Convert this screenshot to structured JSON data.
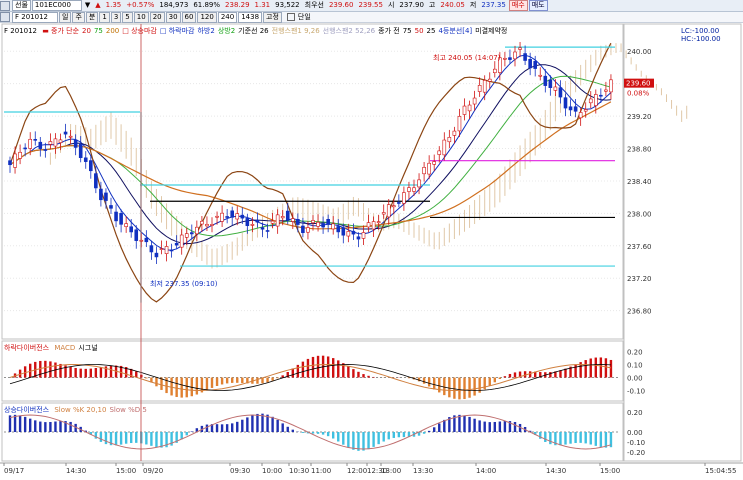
{
  "toolbar1": {
    "type_select": "선물",
    "code_field": "101EC000",
    "arrow_down": "▼",
    "change_label": "▲",
    "change_value": "1.35",
    "change_pct": "+0.57%",
    "volume": "184,973",
    "ratio": "61.89%",
    "price1": "238.29",
    "price2": "1.31",
    "volume2": "93,522",
    "best_ask_label": "최우선",
    "best_ask": "239.60",
    "best_bid": "239.55",
    "open_label": "시",
    "open": "237.90",
    "high_label": "고",
    "high": "240.05",
    "low_label": "저",
    "low": "237.35",
    "buy_button": "매수",
    "sell_button": "매도"
  },
  "toolbar2": {
    "period_select": "F 201012",
    "tab_day": "일",
    "tab_week": "주",
    "tab_min": "분",
    "intervals": [
      "1",
      "3",
      "5",
      "10",
      "20",
      "30",
      "60",
      "120"
    ],
    "count_field": "240",
    "page_field": "1438",
    "lock_label": "고정",
    "checkbox_label": "단일"
  },
  "legends": {
    "price_title": "F 201012",
    "price_items": [
      {
        "text": "▬ 중가 단순",
        "color": "#d01010"
      },
      {
        "text": "20",
        "color": "#d01010"
      },
      {
        "text": "75",
        "color": "#10a010"
      },
      {
        "text": "200",
        "color": "#c07000"
      },
      {
        "text": "□ 상승마감",
        "color": "#d01010"
      },
      {
        "text": "□ 하락마감",
        "color": "#1030c0"
      },
      {
        "text": "하방2",
        "color": "#1030c0"
      },
      {
        "text": "상방2",
        "color": "#10a010"
      },
      {
        "text": "기준선 26",
        "color": "#000000"
      },
      {
        "text": "전행스팬1 9,26",
        "color": "#c8a870"
      },
      {
        "text": "선행스팬2 52,26",
        "color": "#a0a0c0"
      },
      {
        "text": "종가 전",
        "color": "#000000"
      },
      {
        "text": "75",
        "color": "#000000"
      },
      {
        "text": "50",
        "color": "#d01010"
      },
      {
        "text": "25",
        "color": "#000000"
      },
      {
        "text": "4등분선[4]",
        "color": "#1030c0"
      },
      {
        "text": "미결제약정",
        "color": "#000000"
      }
    ],
    "macd_title": "하락다이버전스",
    "macd_items": [
      {
        "text": "MACD",
        "color": "#d08040"
      },
      {
        "text": "시그널",
        "color": "#000000"
      }
    ],
    "stoch_title": "상승다이버전스",
    "stoch_items": [
      {
        "text": "Slow %K 20,10",
        "color": "#d08040"
      },
      {
        "text": "Slow %D 5",
        "color": "#c07070"
      }
    ]
  },
  "annotations": {
    "high_note": "최고 240.05 (14:07)",
    "low_note": "최저 237.35 (09:10)"
  },
  "right_axis": {
    "price_ticks": [
      "240.00",
      "239.60",
      "239.20",
      "238.80",
      "238.40",
      "238.00",
      "237.60",
      "237.20",
      "236.80"
    ],
    "current_price": "239.60",
    "current_pct": "0.08%",
    "top_labels": [
      "LC:-100.00",
      "HC:-100.00"
    ],
    "macd_ticks": [
      "0.20",
      "0.10",
      "0.00",
      "-0.10"
    ],
    "stoch_ticks": [
      "0.20",
      "0.00",
      "-0.10",
      "-0.20"
    ]
  },
  "time_axis": {
    "labels": [
      "09/17",
      "14:30",
      "15:00",
      "09/20",
      "09:30",
      "10:00",
      "10:30",
      "11:00",
      "12:00",
      "12:30",
      "13:00",
      "13:30",
      "14:00",
      "14:30",
      "15:00",
      "15:04:55"
    ]
  },
  "colors": {
    "up_candle": "#d01010",
    "down_candle": "#1030c0",
    "cyan_lines": "#40d0e0",
    "ma_orange": "#d07020",
    "ma_green": "#40b040",
    "ma_magenta": "#e020e0",
    "ma_brown": "#8b4513",
    "cloud_fill": "#e0c8a8"
  }
}
